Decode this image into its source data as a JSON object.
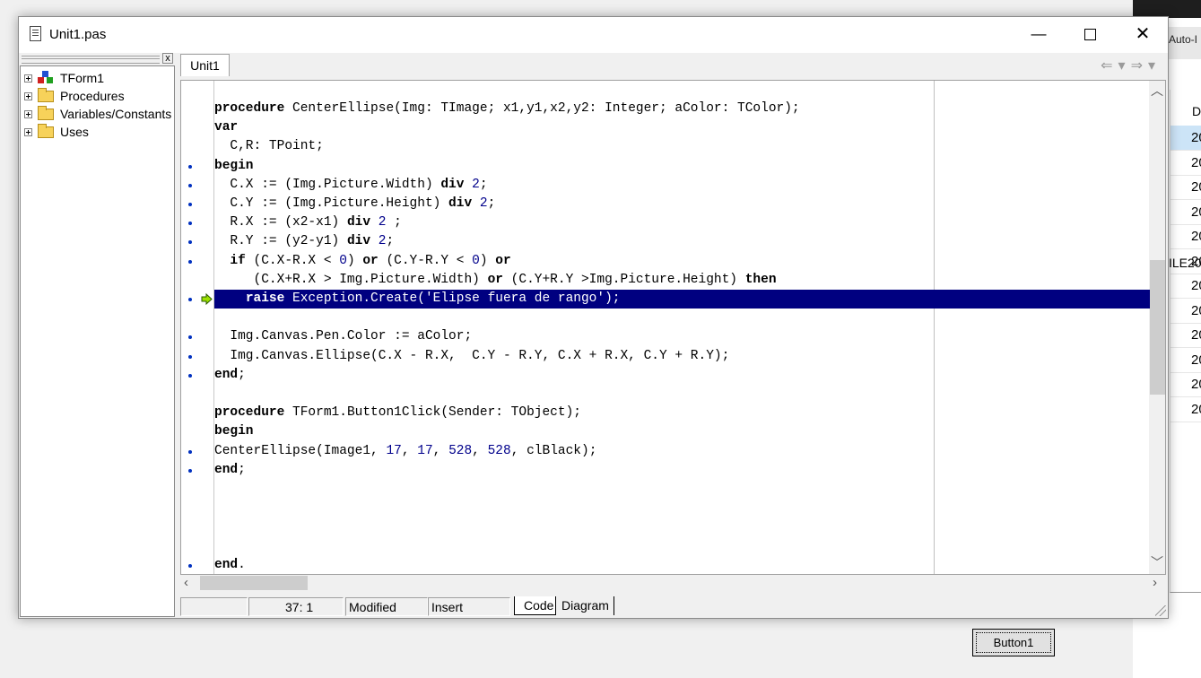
{
  "background": {
    "right_tab_label": "Auto-I",
    "list_header": "D",
    "list_rows": [
      "20",
      "20",
      "20",
      "20",
      "20",
      "20",
      "20",
      "20",
      "20",
      "20",
      "20",
      "20"
    ],
    "ile_text": "ILE20",
    "button1_label": "Button1"
  },
  "window": {
    "title": "Unit1.pas",
    "min_glyph": "—",
    "close_glyph": "✕"
  },
  "explorer": {
    "close_glyph": "x",
    "items": [
      {
        "label": "TForm1",
        "icon": "form-icon"
      },
      {
        "label": "Procedures",
        "icon": "folder-icon"
      },
      {
        "label": "Variables/Constants",
        "icon": "folder-icon"
      },
      {
        "label": "Uses",
        "icon": "folder-icon"
      }
    ]
  },
  "editor": {
    "tab_label": "Unit1",
    "nav_back": "⇐",
    "nav_fwd": "⇒",
    "lines": [
      {
        "segments": [
          [
            "kw",
            "procedure"
          ],
          [
            "t",
            " CenterEllipse(Img: TImage; x1,y1,x2,y2: Integer; aColor: TColor);"
          ]
        ],
        "bp": false
      },
      {
        "segments": [
          [
            "kw",
            "var"
          ]
        ],
        "bp": false
      },
      {
        "segments": [
          [
            "t",
            "  C,R: TPoint;"
          ]
        ],
        "bp": false
      },
      {
        "segments": [
          [
            "kw",
            "begin"
          ]
        ],
        "bp": true
      },
      {
        "segments": [
          [
            "t",
            "  C.X := (Img.Picture.Width) "
          ],
          [
            "kw",
            "div"
          ],
          [
            "t",
            " "
          ],
          [
            "n",
            "2"
          ],
          [
            "t",
            ";"
          ]
        ],
        "bp": true
      },
      {
        "segments": [
          [
            "t",
            "  C.Y := (Img.Picture.Height) "
          ],
          [
            "kw",
            "div"
          ],
          [
            "t",
            " "
          ],
          [
            "n",
            "2"
          ],
          [
            "t",
            ";"
          ]
        ],
        "bp": true
      },
      {
        "segments": [
          [
            "t",
            "  R.X := (x2-x1) "
          ],
          [
            "kw",
            "div"
          ],
          [
            "t",
            " "
          ],
          [
            "n",
            "2"
          ],
          [
            "t",
            " ;"
          ]
        ],
        "bp": true
      },
      {
        "segments": [
          [
            "t",
            "  R.Y := (y2-y1) "
          ],
          [
            "kw",
            "div"
          ],
          [
            "t",
            " "
          ],
          [
            "n",
            "2"
          ],
          [
            "t",
            ";"
          ]
        ],
        "bp": true
      },
      {
        "segments": [
          [
            "t",
            "  "
          ],
          [
            "kw",
            "if"
          ],
          [
            "t",
            " (C.X-R.X < "
          ],
          [
            "n",
            "0"
          ],
          [
            "t",
            ") "
          ],
          [
            "kw",
            "or"
          ],
          [
            "t",
            " (C.Y-R.Y < "
          ],
          [
            "n",
            "0"
          ],
          [
            "t",
            ") "
          ],
          [
            "kw",
            "or"
          ]
        ],
        "bp": true
      },
      {
        "segments": [
          [
            "t",
            "     (C.X+R.X > Img.Picture.Width) "
          ],
          [
            "kw",
            "or"
          ],
          [
            "t",
            " (C.Y+R.Y >Img.Picture.Height) "
          ],
          [
            "kw",
            "then"
          ]
        ],
        "bp": false
      },
      {
        "segments": [
          [
            "t",
            "    "
          ],
          [
            "kw",
            "raise"
          ],
          [
            "t",
            " Exception.Create('Elipse fuera de rango');"
          ]
        ],
        "bp": true,
        "exec": true
      },
      {
        "segments": [
          [
            "t",
            ""
          ]
        ],
        "bp": false
      },
      {
        "segments": [
          [
            "t",
            "  Img.Canvas.Pen.Color := aColor;"
          ]
        ],
        "bp": true
      },
      {
        "segments": [
          [
            "t",
            "  Img.Canvas.Ellipse(C.X - R.X,  C.Y - R.Y, C.X + R.X, C.Y + R.Y);"
          ]
        ],
        "bp": true
      },
      {
        "segments": [
          [
            "kw",
            "end"
          ],
          [
            "t",
            ";"
          ]
        ],
        "bp": true
      },
      {
        "segments": [
          [
            "t",
            ""
          ]
        ],
        "bp": false
      },
      {
        "segments": [
          [
            "kw",
            "procedure"
          ],
          [
            "t",
            " TForm1.Button1Click(Sender: TObject);"
          ]
        ],
        "bp": false
      },
      {
        "segments": [
          [
            "kw",
            "begin"
          ]
        ],
        "bp": false
      },
      {
        "segments": [
          [
            "t",
            "CenterEllipse(Image1, "
          ],
          [
            "n",
            "17"
          ],
          [
            "t",
            ", "
          ],
          [
            "n",
            "17"
          ],
          [
            "t",
            ", "
          ],
          [
            "n",
            "528"
          ],
          [
            "t",
            ", "
          ],
          [
            "n",
            "528"
          ],
          [
            "t",
            ", clBlack);"
          ]
        ],
        "bp": true
      },
      {
        "segments": [
          [
            "kw",
            "end"
          ],
          [
            "t",
            ";"
          ]
        ],
        "bp": true
      },
      {
        "segments": [
          [
            "t",
            ""
          ]
        ],
        "bp": false
      },
      {
        "segments": [
          [
            "t",
            ""
          ]
        ],
        "bp": false
      },
      {
        "segments": [
          [
            "t",
            ""
          ]
        ],
        "bp": false
      },
      {
        "segments": [
          [
            "t",
            ""
          ]
        ],
        "bp": false
      },
      {
        "segments": [
          [
            "kw",
            "end"
          ],
          [
            "t",
            "."
          ]
        ],
        "bp": true
      }
    ]
  },
  "statusbar": {
    "position": "37:  1",
    "modified": "Modified",
    "mode": "Insert",
    "tab_code": "Code",
    "tab_diagram": "Diagram"
  },
  "colors": {
    "exec_line_bg": "#000080",
    "number_color": "#00008b",
    "breakpoint_dot": "#0030c0"
  }
}
